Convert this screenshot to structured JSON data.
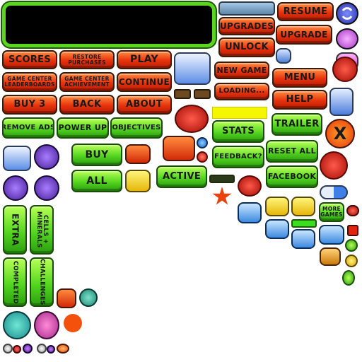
{
  "colors": {
    "red_button": "#e8320c",
    "green_button": "#55d620",
    "yellow_bar": "#f6f600",
    "black_panel": "#000000",
    "outline_dark": "#3b1a07"
  },
  "red_buttons": {
    "resume": "RESUME",
    "upgrades": "UPGRADES",
    "upgrade": "UPGRADE",
    "unlock": "UNLOCK",
    "scores": "SCORES",
    "restore_purchases": "RESTORE PURCHASES",
    "play": "PLAY",
    "game_center_leaderboards": "GAME CENTER LEADERBOARDS",
    "game_center_achievement": "GAME CENTER ACHIEVEMENT",
    "continue": "CONTINUE",
    "new_game": "NEW GAME",
    "menu": "MENU",
    "loading": "LOADING...",
    "help": "HELP",
    "buy3": "BUY 3",
    "back": "BACK",
    "about": "ABOUT"
  },
  "green_buttons": {
    "remove_ads": "REMOVE ADS",
    "power_up": "POWER UP",
    "objectives": "OBJECTIVES",
    "stats": "STATS",
    "trailer": "TRAILER",
    "buy": "BUY",
    "all": "ALL",
    "active": "ACTIVE",
    "feedback": "FEEDBACK?",
    "reset_all": "RESET ALL",
    "facebook": "FACEBOOK",
    "more_games": "MORE GAMES",
    "extra": "EXTRA",
    "cells_minerals": "CELLS + MINERALS",
    "completed": "COMPLETED",
    "challenges": "CHALLENGES"
  },
  "icons": [
    "refresh-icon",
    "shuffle-icon",
    "pill-capsules-icon",
    "arrow-right-icon",
    "arrow-left-icon",
    "red-cells-icon",
    "close-x-icon",
    "trophy-icon",
    "lightning-icon",
    "ribbon-medal-icon",
    "sound-icon",
    "mute-icon",
    "lock-icon",
    "heart-icon",
    "book-icon",
    "plus-minus-icon",
    "star-burst-icon"
  ]
}
